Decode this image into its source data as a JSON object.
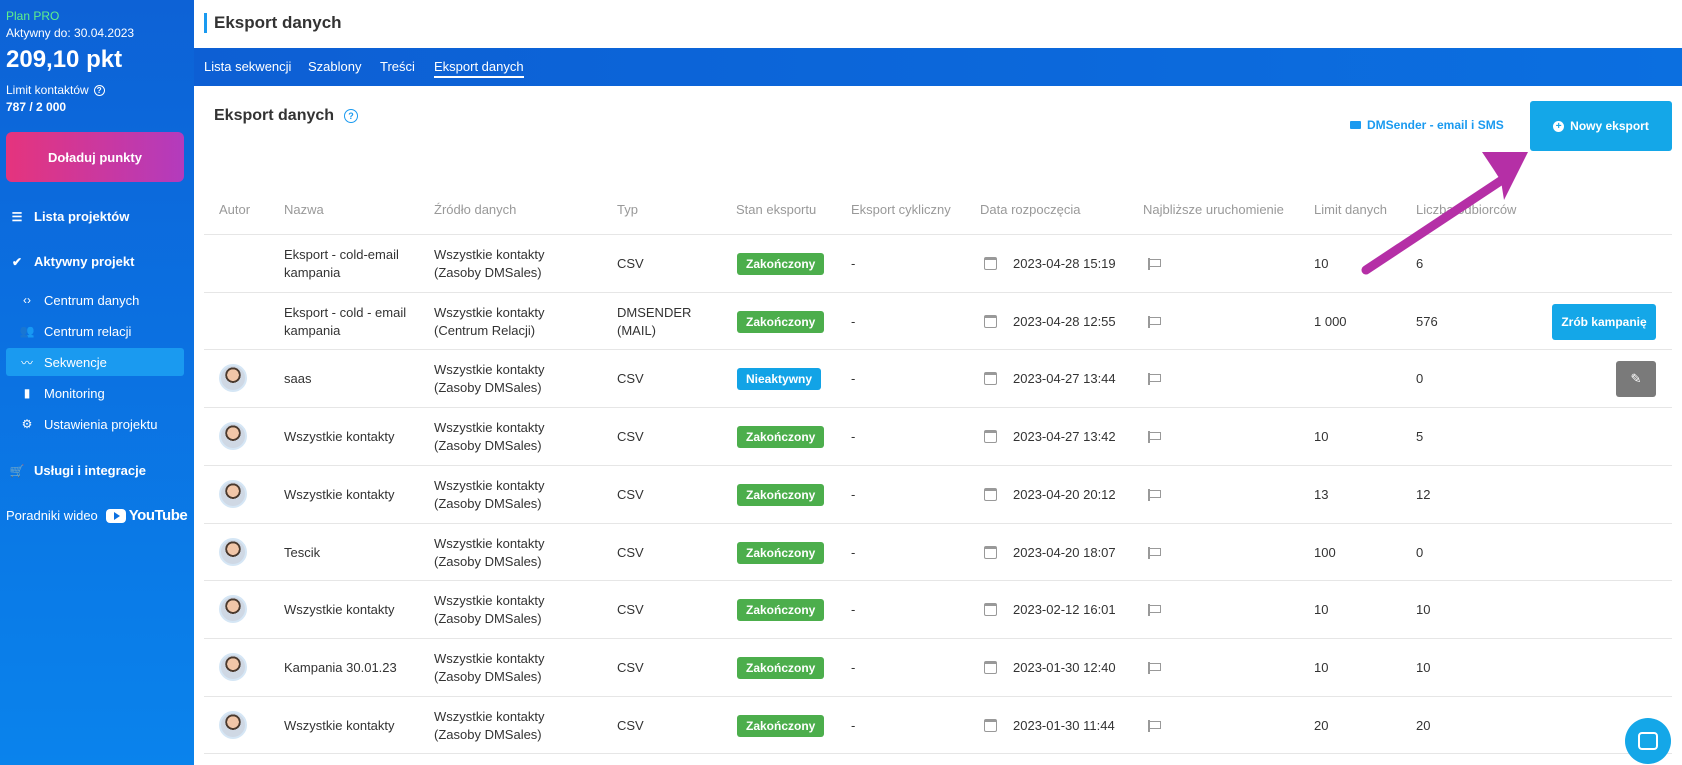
{
  "sidebar": {
    "plan": "Plan PRO",
    "active_until": "Aktywny do: 30.04.2023",
    "points": "209,10 pkt",
    "contact_limit_label": "Limit kontaktów",
    "contact_limit_value": "787 / 2 000",
    "topup_label": "Doładuj punkty",
    "project_list": "Lista projektów",
    "active_project": "Aktywny projekt",
    "sub_items": [
      "Centrum danych",
      "Centrum relacji",
      "Sekwencje",
      "Monitoring",
      "Ustawienia projektu"
    ],
    "active_sub_item": "Sekwencje",
    "services": "Usługi i integracje",
    "video_guides": "Poradniki wideo",
    "youtube_logo": "YouTube"
  },
  "header": {
    "title": "Eksport danych"
  },
  "tabs": [
    "Lista sekwencji",
    "Szablony",
    "Treści",
    "Eksport danych"
  ],
  "active_tab": "Eksport danych",
  "section": {
    "title": "Eksport danych",
    "dms_link": "DMSender - email i SMS",
    "new_export_button": "Nowy eksport"
  },
  "table": {
    "headers": [
      "Autor",
      "Nazwa",
      "Źródło danych",
      "Typ",
      "Stan eksportu",
      "Eksport cykliczny",
      "Data rozpoczęcia",
      "Najbliższe uruchomienie",
      "Limit danych",
      "Liczba odbiorców"
    ],
    "rows": [
      {
        "name": "Eksport - cold-email kampania",
        "source": "Wszystkie kontakty (Zasoby DMSales)",
        "type": "CSV",
        "status": "Zakończony",
        "cyclic": "-",
        "date": "2023-04-28 15:19",
        "limit": "10",
        "recipients": "6",
        "avatar": false
      },
      {
        "name": "Eksport - cold - email kampania",
        "source": "Wszystkie kontakty (Centrum Relacji)",
        "type": "DMSENDER (MAIL)",
        "status": "Zakończony",
        "cyclic": "-",
        "date": "2023-04-28 12:55",
        "limit": "1 000",
        "recipients": "576",
        "avatar": false,
        "action": "Zrób kampanię"
      },
      {
        "name": "saas",
        "source": "Wszystkie kontakty (Zasoby DMSales)",
        "type": "CSV",
        "status": "Nieaktywny",
        "cyclic": "-",
        "date": "2023-04-27 13:44",
        "limit": "",
        "recipients": "0",
        "avatar": true,
        "edit": true
      },
      {
        "name": "Wszystkie kontakty",
        "source": "Wszystkie kontakty (Zasoby DMSales)",
        "type": "CSV",
        "status": "Zakończony",
        "cyclic": "-",
        "date": "2023-04-27 13:42",
        "limit": "10",
        "recipients": "5",
        "avatar": true
      },
      {
        "name": "Wszystkie kontakty",
        "source": "Wszystkie kontakty (Zasoby DMSales)",
        "type": "CSV",
        "status": "Zakończony",
        "cyclic": "-",
        "date": "2023-04-20 20:12",
        "limit": "13",
        "recipients": "12",
        "avatar": true
      },
      {
        "name": "Tescik",
        "source": "Wszystkie kontakty (Zasoby DMSales)",
        "type": "CSV",
        "status": "Zakończony",
        "cyclic": "-",
        "date": "2023-04-20 18:07",
        "limit": "100",
        "recipients": "0",
        "avatar": true
      },
      {
        "name": "Wszystkie kontakty",
        "source": "Wszystkie kontakty (Zasoby DMSales)",
        "type": "CSV",
        "status": "Zakończony",
        "cyclic": "-",
        "date": "2023-02-12 16:01",
        "limit": "10",
        "recipients": "10",
        "avatar": true
      },
      {
        "name": "Kampania 30.01.23",
        "source": "Wszystkie kontakty (Zasoby DMSales)",
        "type": "CSV",
        "status": "Zakończony",
        "cyclic": "-",
        "date": "2023-01-30 12:40",
        "limit": "10",
        "recipients": "10",
        "avatar": true
      },
      {
        "name": "Wszystkie kontakty",
        "source": "Wszystkie kontakty (Zasoby DMSales)",
        "type": "CSV",
        "status": "Zakończony",
        "cyclic": "-",
        "date": "2023-01-30 11:44",
        "limit": "20",
        "recipients": "20",
        "avatar": true
      }
    ]
  },
  "colors": {
    "accent": "#14a7e8",
    "done": "#4cae4c",
    "annotation_arrow": "#b52fa6"
  }
}
